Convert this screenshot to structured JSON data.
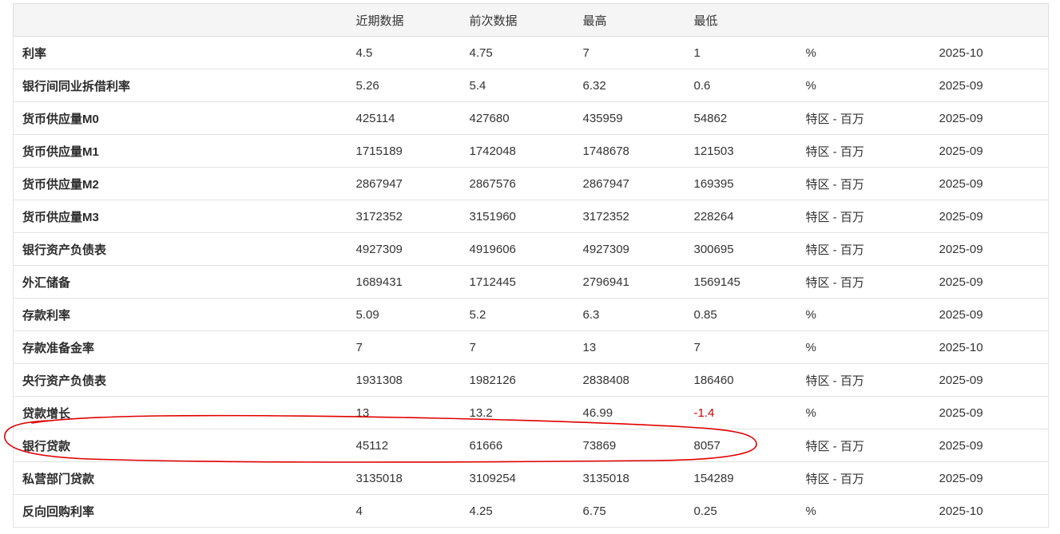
{
  "table": {
    "headers": [
      "",
      "近期数据",
      "前次数据",
      "最高",
      "最低",
      "",
      ""
    ],
    "rows": [
      {
        "name": "利率",
        "latest": "4.5",
        "previous": "4.75",
        "high": "7",
        "low": "1",
        "unit": "%",
        "date": "2025-10"
      },
      {
        "name": "银行间同业拆借利率",
        "latest": "5.26",
        "previous": "5.4",
        "high": "6.32",
        "low": "0.6",
        "unit": "%",
        "date": "2025-09"
      },
      {
        "name": "货币供应量M0",
        "latest": "425114",
        "previous": "427680",
        "high": "435959",
        "low": "54862",
        "unit": "特区 - 百万",
        "date": "2025-09"
      },
      {
        "name": "货币供应量M1",
        "latest": "1715189",
        "previous": "1742048",
        "high": "1748678",
        "low": "121503",
        "unit": "特区 - 百万",
        "date": "2025-09"
      },
      {
        "name": "货币供应量M2",
        "latest": "2867947",
        "previous": "2867576",
        "high": "2867947",
        "low": "169395",
        "unit": "特区 - 百万",
        "date": "2025-09"
      },
      {
        "name": "货币供应量M3",
        "latest": "3172352",
        "previous": "3151960",
        "high": "3172352",
        "low": "228264",
        "unit": "特区 - 百万",
        "date": "2025-09"
      },
      {
        "name": "银行资产负债表",
        "latest": "4927309",
        "previous": "4919606",
        "high": "4927309",
        "low": "300695",
        "unit": "特区 - 百万",
        "date": "2025-09"
      },
      {
        "name": "外汇储备",
        "latest": "1689431",
        "previous": "1712445",
        "high": "2796941",
        "low": "1569145",
        "unit": "特区 - 百万",
        "date": "2025-09"
      },
      {
        "name": "存款利率",
        "latest": "5.09",
        "previous": "5.2",
        "high": "6.3",
        "low": "0.85",
        "unit": "%",
        "date": "2025-09"
      },
      {
        "name": "存款准备金率",
        "latest": "7",
        "previous": "7",
        "high": "13",
        "low": "7",
        "unit": "%",
        "date": "2025-10"
      },
      {
        "name": "央行资产负债表",
        "latest": "1931308",
        "previous": "1982126",
        "high": "2838408",
        "low": "186460",
        "unit": "特区 - 百万",
        "date": "2025-09"
      },
      {
        "name": "贷款增长",
        "latest": "13",
        "previous": "13.2",
        "high": "46.99",
        "low": "-1.4",
        "unit": "%",
        "date": "2025-09"
      },
      {
        "name": "银行贷款",
        "latest": "45112",
        "previous": "61666",
        "high": "73869",
        "low": "8057",
        "unit": "特区 - 百万",
        "date": "2025-09"
      },
      {
        "name": "私营部门贷款",
        "latest": "3135018",
        "previous": "3109254",
        "high": "3135018",
        "low": "154289",
        "unit": "特区 - 百万",
        "date": "2025-09"
      },
      {
        "name": "反向回购利率",
        "latest": "4",
        "previous": "4.25",
        "high": "6.75",
        "low": "0.25",
        "unit": "%",
        "date": "2025-10"
      }
    ]
  },
  "colors": {
    "header_bg": "#f5f5f5",
    "border": "#e2e2e2",
    "negative": "#cc0000",
    "annotation": "#e00000"
  },
  "annotation": {
    "highlighted_row": "银行贷款",
    "shape": "hand-drawn-ellipse"
  }
}
